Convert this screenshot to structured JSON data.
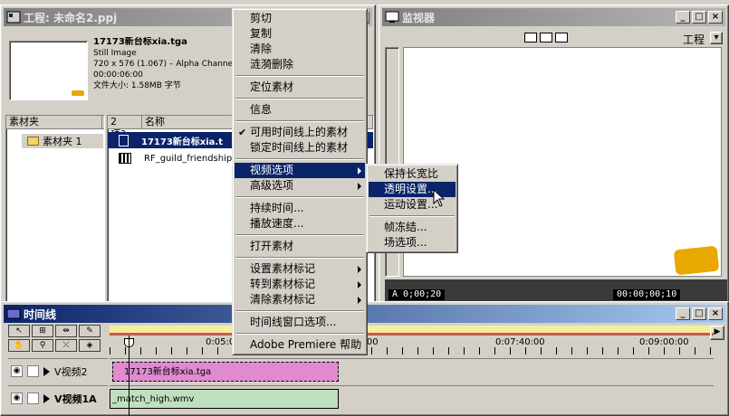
{
  "project": {
    "title": "工程: 未命名2.ppj",
    "clip": {
      "name": "17173新台标xia.tga",
      "type": "Still Image",
      "dims": "720 x 576 (1.067) – Alpha Channe",
      "duration": "00:00:06:00",
      "size": "文件大小: 1.58MB 字节"
    },
    "bin_header": "素材夹",
    "bin_item": "素材夹 1",
    "file_header_count": "2 项?..",
    "file_header_name": "名称",
    "files": [
      {
        "name": "17173新台标xia.t"
      },
      {
        "name": "RF_guild_friendship_r"
      }
    ]
  },
  "monitor": {
    "title": "监视器",
    "dropdown_label": "工程",
    "timecode_left": "A 0;00;20",
    "timecode_right": "00:00;00;10"
  },
  "timeline": {
    "title": "时间线",
    "ruler_labels": [
      "0:05:0",
      "0:02:20:00",
      "0:07:40:00",
      "0:09:00:00"
    ],
    "tracks": [
      {
        "name": "V视频2",
        "clip": "17173新台标xia.tga"
      },
      {
        "name": "V视频1A",
        "clip": "_match_high.wmv"
      }
    ]
  },
  "context_menu": {
    "items": [
      "剪切",
      "复制",
      "清除",
      "涟漪删除",
      "定位素材",
      "信息",
      "可用时间线上的素材",
      "锁定时间线上的素材",
      "视频选项",
      "高级选项",
      "持续时间...",
      "播放速度...",
      "打开素材",
      "设置素材标记",
      "转到素材标记",
      "清除素材标记",
      "时间线窗口选项...",
      "Adobe Premiere 帮助"
    ]
  },
  "submenu": {
    "items": [
      "保持长宽比",
      "透明设置...",
      "运动设置...",
      "帧冻结...",
      "场选项..."
    ]
  },
  "colors": {
    "title_active": "#0a246a",
    "selection": "#0a246a",
    "clip_image": "#e08ad0",
    "clip_video": "#bfe0bf",
    "work_area": "#f4ef9e"
  }
}
